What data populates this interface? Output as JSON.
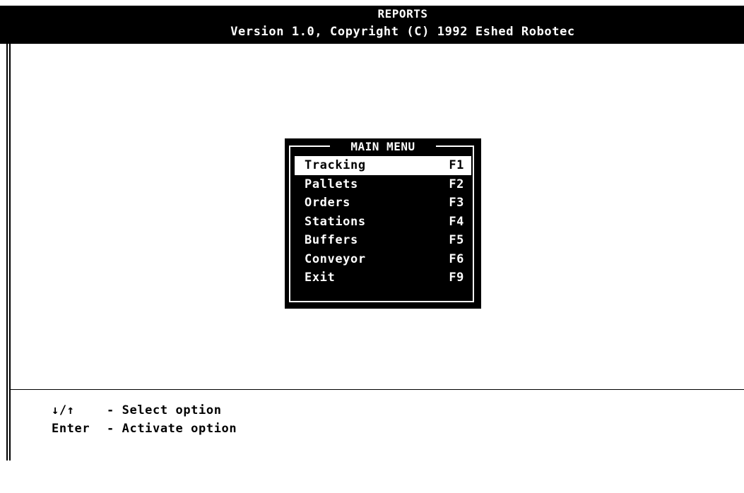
{
  "header": {
    "title": "REPORTS",
    "subtitle": "Version 1.0, Copyright (C) 1992 Eshed Robotec"
  },
  "menu": {
    "title": "MAIN MENU",
    "items": [
      {
        "label": "Tracking",
        "key": "F1"
      },
      {
        "label": "Pallets",
        "key": "F2"
      },
      {
        "label": "Orders",
        "key": "F3"
      },
      {
        "label": "Stations",
        "key": "F4"
      },
      {
        "label": "Buffers",
        "key": "F5"
      },
      {
        "label": "Conveyor",
        "key": "F6"
      },
      {
        "label": "Exit",
        "key": "F9"
      }
    ],
    "selected_label": "Tracking"
  },
  "help": [
    {
      "key": "↓/↑",
      "text": "- Select option"
    },
    {
      "key": "Enter",
      "text": "- Activate option"
    }
  ],
  "colors": {
    "background": "#ffffff",
    "foreground": "#000000",
    "highlight": "#ffffff"
  }
}
